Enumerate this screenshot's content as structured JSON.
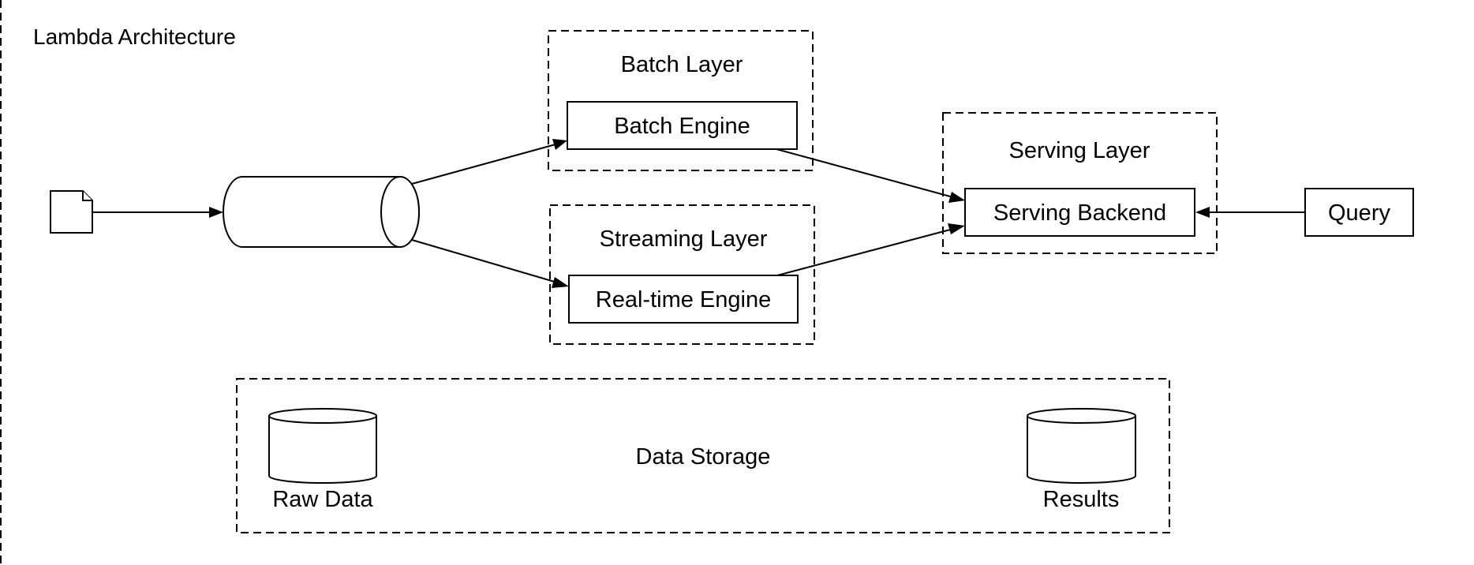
{
  "title": "Lambda Architecture",
  "colors": {
    "stroke": "#000000",
    "background": "#ffffff",
    "text": "#000000"
  },
  "nodes": {
    "source_document": {
      "label": "",
      "icon": "document-icon"
    },
    "message_queue": {
      "label": "",
      "icon": "queue-cylinder-icon"
    },
    "batch_engine": {
      "label": "Batch Engine"
    },
    "realtime_engine": {
      "label": "Real-time Engine"
    },
    "serving_backend": {
      "label": "Serving Backend"
    },
    "query": {
      "label": "Query"
    },
    "raw_data": {
      "label": "Raw Data",
      "icon": "database-icon"
    },
    "results": {
      "label": "Results",
      "icon": "database-icon"
    }
  },
  "groups": {
    "batch_layer": {
      "label": "Batch Layer"
    },
    "streaming_layer": {
      "label": "Streaming Layer"
    },
    "serving_layer": {
      "label": "Serving Layer"
    },
    "data_storage": {
      "label": "Data Storage"
    }
  },
  "edges": [
    {
      "from": "source_document",
      "to": "message_queue"
    },
    {
      "from": "message_queue",
      "to": "batch_engine"
    },
    {
      "from": "message_queue",
      "to": "realtime_engine"
    },
    {
      "from": "batch_engine",
      "to": "serving_backend"
    },
    {
      "from": "realtime_engine",
      "to": "serving_backend"
    },
    {
      "from": "query",
      "to": "serving_backend"
    }
  ]
}
